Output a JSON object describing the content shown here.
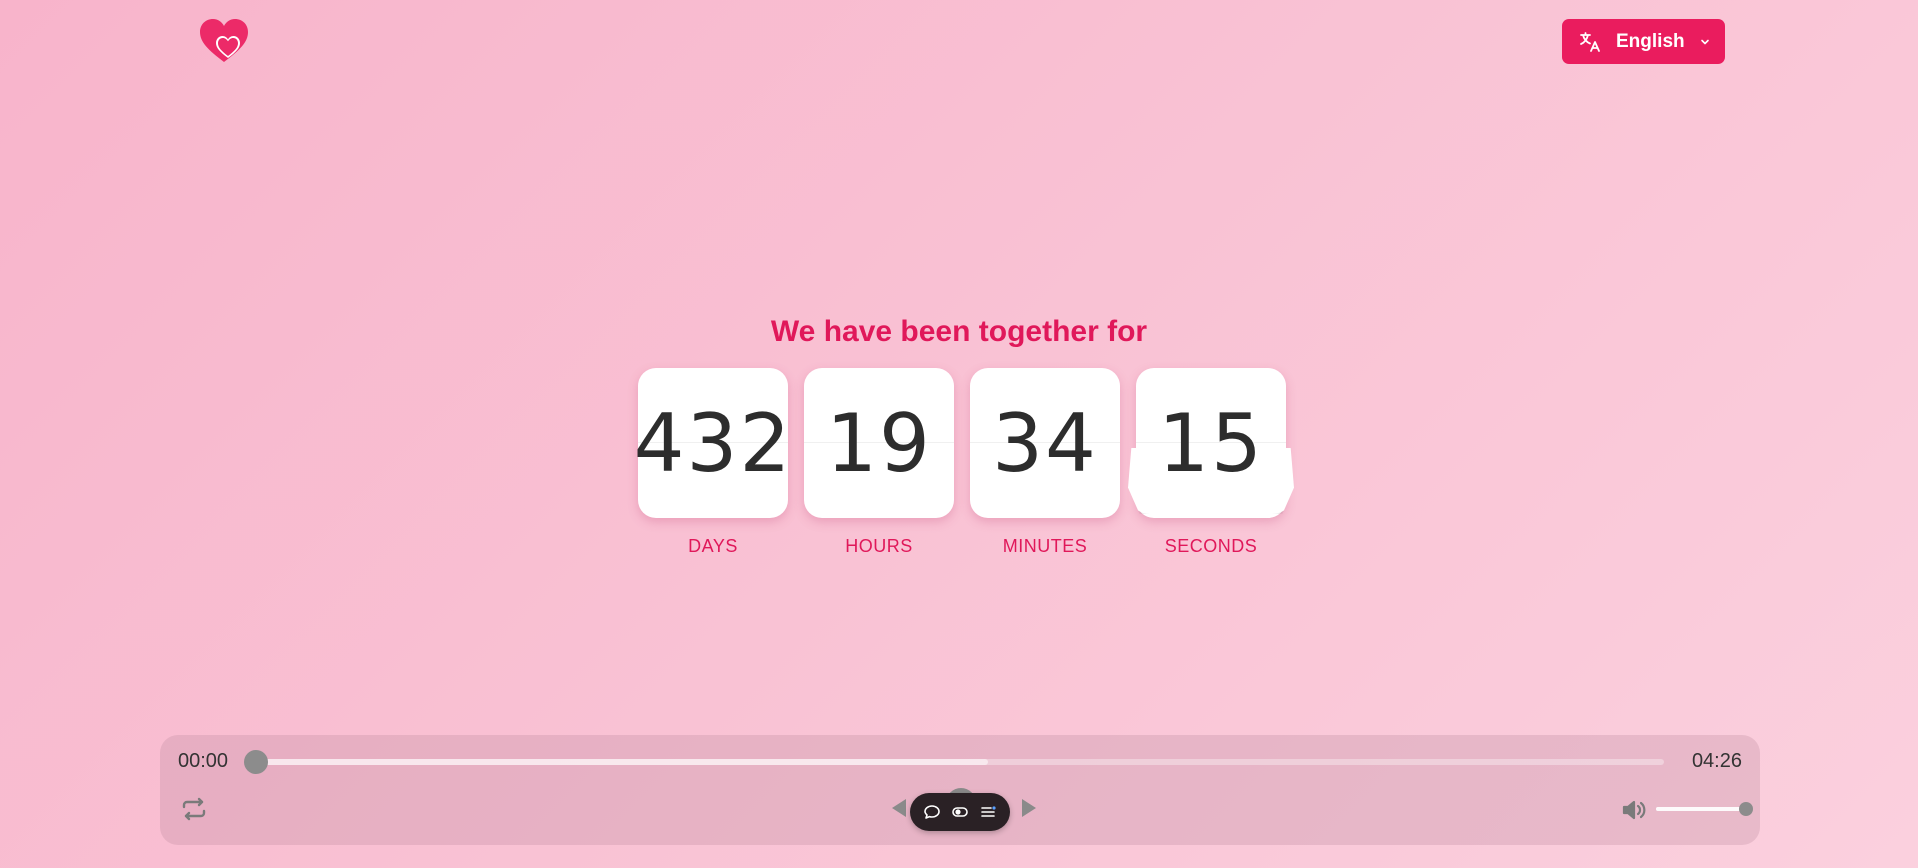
{
  "header": {
    "logo_icon": "double-heart-icon",
    "language": {
      "label": "English",
      "icon": "translate-icon",
      "chevron": "chevron-down-icon"
    }
  },
  "main": {
    "heading": "We have been together for",
    "counter": [
      {
        "value": "432",
        "label": "DAYS"
      },
      {
        "value": "19",
        "label": "HOURS"
      },
      {
        "value": "34",
        "label": "MINUTES"
      },
      {
        "value": "15",
        "label": "SECONDS"
      }
    ]
  },
  "player": {
    "current_time": "00:00",
    "duration": "04:26",
    "progress_fraction": 0.0,
    "buffered_fraction": 0.52,
    "volume_fraction": 1.0,
    "icons": {
      "loop": "repeat-icon",
      "prev": "triangle-left-icon",
      "next": "triangle-right-icon",
      "volume": "volume-icon",
      "toolbar": [
        "chat-bubble-icon",
        "toggle-icon",
        "list-icon"
      ]
    }
  },
  "colors": {
    "accent": "#ea1c5e",
    "heading": "#e0185a",
    "toolbar_bg": "#2a2125"
  }
}
